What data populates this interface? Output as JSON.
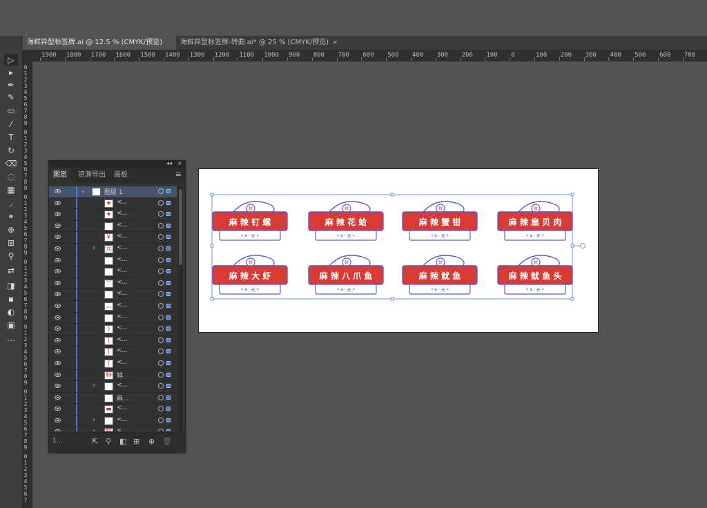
{
  "tabs": [
    {
      "label": "海鲜异型标签牌.ai @ 12.5 % (CMYK/预览)",
      "active": true
    },
    {
      "label": "海鲜异型标签牌-转曲.ai* @ 25 % (CMYK/预览)",
      "active": false
    }
  ],
  "close_glyph": "×",
  "ruler_top_labels": [
    "1900",
    "1800",
    "1700",
    "1600",
    "1500",
    "1400",
    "1300",
    "1200",
    "1100",
    "1000",
    "900",
    "800",
    "700",
    "600",
    "500",
    "400",
    "300",
    "200",
    "100",
    "0",
    "100",
    "200",
    "300",
    "400",
    "500",
    "600",
    "700"
  ],
  "ruler_left_labels": [
    "0",
    "1",
    "2",
    "3",
    "4",
    "5",
    "6",
    "7",
    "8",
    "9"
  ],
  "tools": [
    {
      "icon": "selection-arrow-icon",
      "glyph": "▷"
    },
    {
      "icon": "direct-select-icon",
      "glyph": "▸"
    },
    {
      "icon": "pen-icon",
      "glyph": "✒"
    },
    {
      "icon": "curvature-icon",
      "glyph": "✎"
    },
    {
      "icon": "rectangle-icon",
      "glyph": "▭"
    },
    {
      "icon": "brush-icon",
      "glyph": "⁄"
    },
    {
      "icon": "type-icon",
      "glyph": "T"
    },
    {
      "icon": "rotate-icon",
      "glyph": "↻"
    },
    {
      "icon": "eraser-icon",
      "glyph": "⌫"
    },
    {
      "icon": "warp-icon",
      "glyph": "◌"
    },
    {
      "icon": "gradient-icon",
      "glyph": "▦"
    },
    {
      "icon": "eyedropper-icon",
      "glyph": "⸝"
    },
    {
      "icon": "blend-icon",
      "glyph": "⚭"
    },
    {
      "icon": "shape-builder-icon",
      "glyph": "⊕"
    },
    {
      "icon": "artboard-icon",
      "glyph": "⊞"
    },
    {
      "icon": "zoom-icon",
      "glyph": "⚲"
    },
    {
      "icon": "swap-colors-icon",
      "glyph": "⇄"
    },
    {
      "icon": "fill-stroke-icon",
      "glyph": "◨"
    },
    {
      "icon": "color-mode-icon",
      "glyph": "▪"
    },
    {
      "icon": "draw-mode-icon",
      "glyph": "◐"
    },
    {
      "icon": "screen-mode-icon",
      "glyph": "▣"
    },
    {
      "icon": "more-tools-icon",
      "glyph": "⋯"
    }
  ],
  "layers_panel": {
    "tabs": [
      "图层",
      "资源导出",
      "画板"
    ],
    "menu_glyph": "≡",
    "collapse_glyph": "◂◂",
    "close_glyph": "×",
    "rows": [
      {
        "name": "图层 1",
        "thumb": "",
        "chevron": "⌄",
        "parent": true
      },
      {
        "name": "<...",
        "thumb": "★",
        "chevron": ""
      },
      {
        "name": "<...",
        "thumb": "★",
        "chevron": ""
      },
      {
        "name": "<...",
        "thumb": "",
        "chevron": ""
      },
      {
        "name": "<...",
        "thumb": "¥",
        "chevron": ""
      },
      {
        "name": "<...",
        "thumb": "元",
        "chevron": "›"
      },
      {
        "name": "<...",
        "thumb": "",
        "chevron": ""
      },
      {
        "name": "<...",
        "thumb": "",
        "chevron": ""
      },
      {
        "name": "<...",
        "thumb": "︶",
        "chevron": ""
      },
      {
        "name": "<...",
        "thumb": "",
        "chevron": ""
      },
      {
        "name": "<...",
        "thumb": "︵",
        "chevron": ""
      },
      {
        "name": "<...",
        "thumb": "",
        "chevron": ""
      },
      {
        "name": "<...",
        "thumb": ")",
        "chevron": ""
      },
      {
        "name": "<...",
        "thumb": "(",
        "chevron": ""
      },
      {
        "name": "<...",
        "thumb": "(",
        "chevron": ""
      },
      {
        "name": "<...",
        "thumb": "(",
        "chevron": ""
      },
      {
        "name": "鲜",
        "thumb": "鲜",
        "chevron": ""
      },
      {
        "name": "<...",
        "thumb": "",
        "chevron": "›"
      },
      {
        "name": "麻...",
        "thumb": "",
        "chevron": ""
      },
      {
        "name": "<...",
        "thumb": "▬",
        "chevron": ""
      },
      {
        "name": "<...",
        "thumb": "",
        "chevron": "›"
      },
      {
        "name": "<...",
        "thumb": "鲜",
        "chevron": "›"
      },
      {
        "name": "<...",
        "thumb": "",
        "chevron": ""
      }
    ],
    "footer_count": "1...",
    "footer_icons": [
      "export-icon",
      "search-icon",
      "clip-icon",
      "new-sublayer-icon",
      "new-layer-icon",
      "delete-icon"
    ]
  },
  "artwork": {
    "signs": [
      {
        "text": "麻 辣 钉 螺",
        "sub": "* ¥ · 元 *"
      },
      {
        "text": "麻 辣 花 蛤",
        "sub": "* ¥ · 元 *"
      },
      {
        "text": "麻 辣 蟹 钳",
        "sub": "* ¥ · 元 *"
      },
      {
        "text": "麻 辣 扇 贝 肉",
        "sub": "* ¥ · 元 *"
      },
      {
        "text": "麻 辣 大 虾",
        "sub": "* ¥ · 元 *"
      },
      {
        "text": "麻 辣 八 爪 鱼",
        "sub": "* ¥ · 元 *"
      },
      {
        "text": "麻 辣 鱿 鱼",
        "sub": "* ¥ · 元 *"
      },
      {
        "text": "麻 辣 鱿 鱼 头",
        "sub": "* ¥ · 元 *"
      }
    ],
    "badge": "鲜",
    "colors": {
      "red": "#d83a34",
      "outline": "#5a5ad8",
      "selection": "#4a7bdc"
    }
  }
}
